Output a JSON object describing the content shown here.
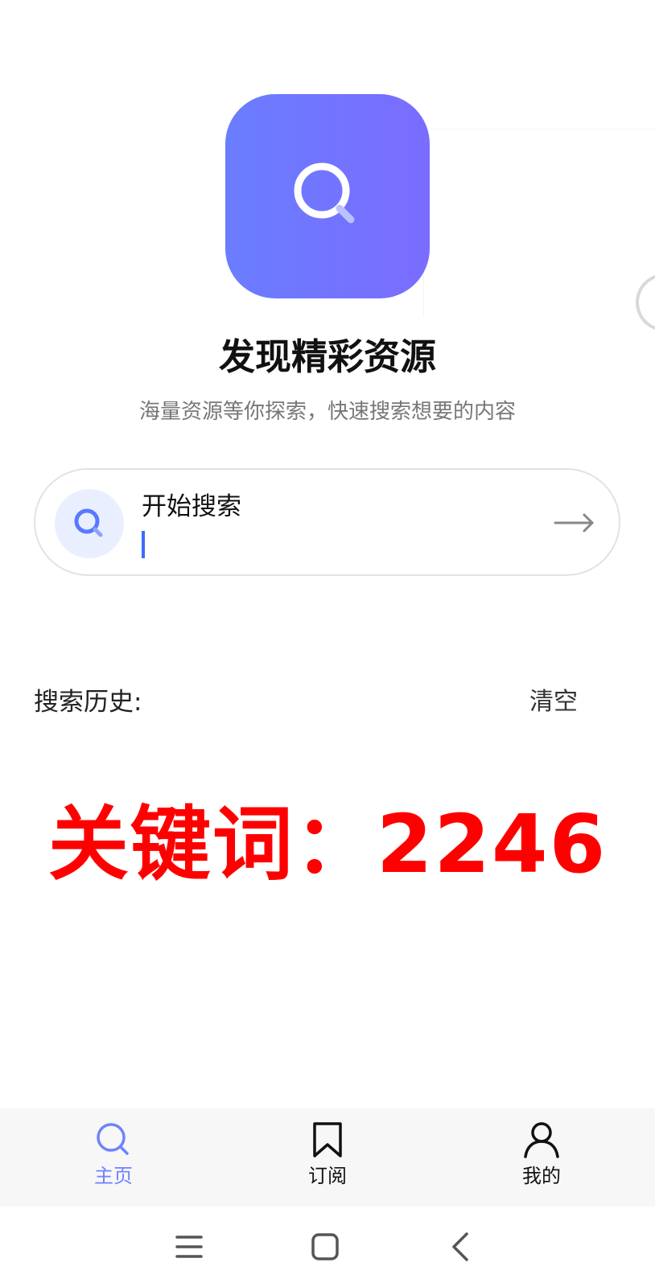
{
  "hero": {
    "title": "发现精彩资源",
    "subtitle": "海量资源等你探索，快速搜索想要的内容",
    "icon": "search-icon",
    "gradient_start": "#6a7dff",
    "gradient_end": "#7a6cff"
  },
  "search": {
    "label": "开始搜索",
    "value": "",
    "placeholder": "",
    "submit_icon": "arrow-right-icon"
  },
  "history": {
    "label": "搜索历史:",
    "clear_label": "清空"
  },
  "overlay": {
    "text": "关键词：2246",
    "color": "#ff0000"
  },
  "bottom_nav": {
    "items": [
      {
        "label": "主页",
        "icon": "search-icon",
        "active": true
      },
      {
        "label": "订阅",
        "icon": "bookmark-icon",
        "active": false
      },
      {
        "label": "我的",
        "icon": "user-icon",
        "active": false
      }
    ],
    "active_color": "#6d83ff"
  },
  "system_nav": {
    "buttons": [
      "menu-icon",
      "home-icon",
      "back-icon"
    ]
  }
}
